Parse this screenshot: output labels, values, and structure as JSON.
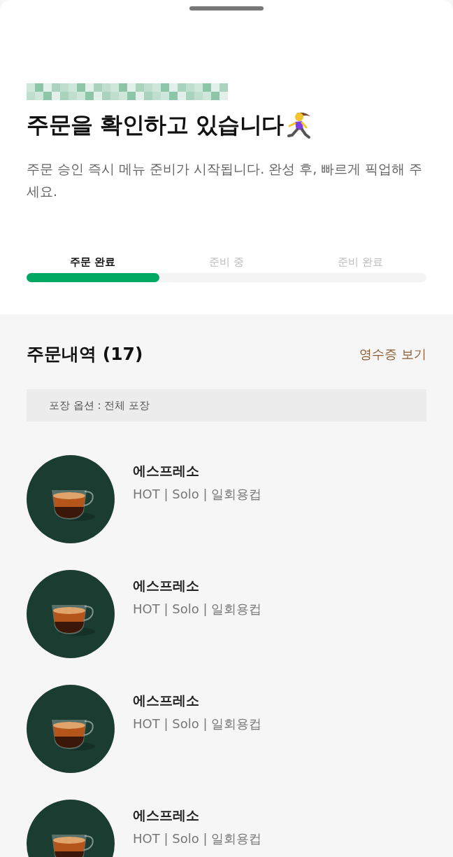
{
  "header": {
    "title": "주문을 확인하고 있습니다",
    "description": "주문 승인 즉시 메뉴 준비가 시작됩니다. 완성 후, 빠르게 픽업해 주세요."
  },
  "progress": {
    "level": 0.333,
    "steps": [
      {
        "label": "주문 완료",
        "selected": true
      },
      {
        "label": "준비 중",
        "selected": false
      },
      {
        "label": "준비 완료",
        "selected": false
      }
    ]
  },
  "order": {
    "title": "주문내역 (17)",
    "receipt_link": "영수증 보기",
    "packaging": "포장 옵션 : 전체 포장",
    "items": [
      {
        "name": "에스프레소",
        "options": "HOT | Solo | 일회용컵"
      },
      {
        "name": "에스프레소",
        "options": "HOT | Solo | 일회용컵"
      },
      {
        "name": "에스프레소",
        "options": "HOT | Solo | 일회용컵"
      },
      {
        "name": "에스프레소",
        "options": "HOT | Solo | 일회용컵"
      }
    ]
  }
}
